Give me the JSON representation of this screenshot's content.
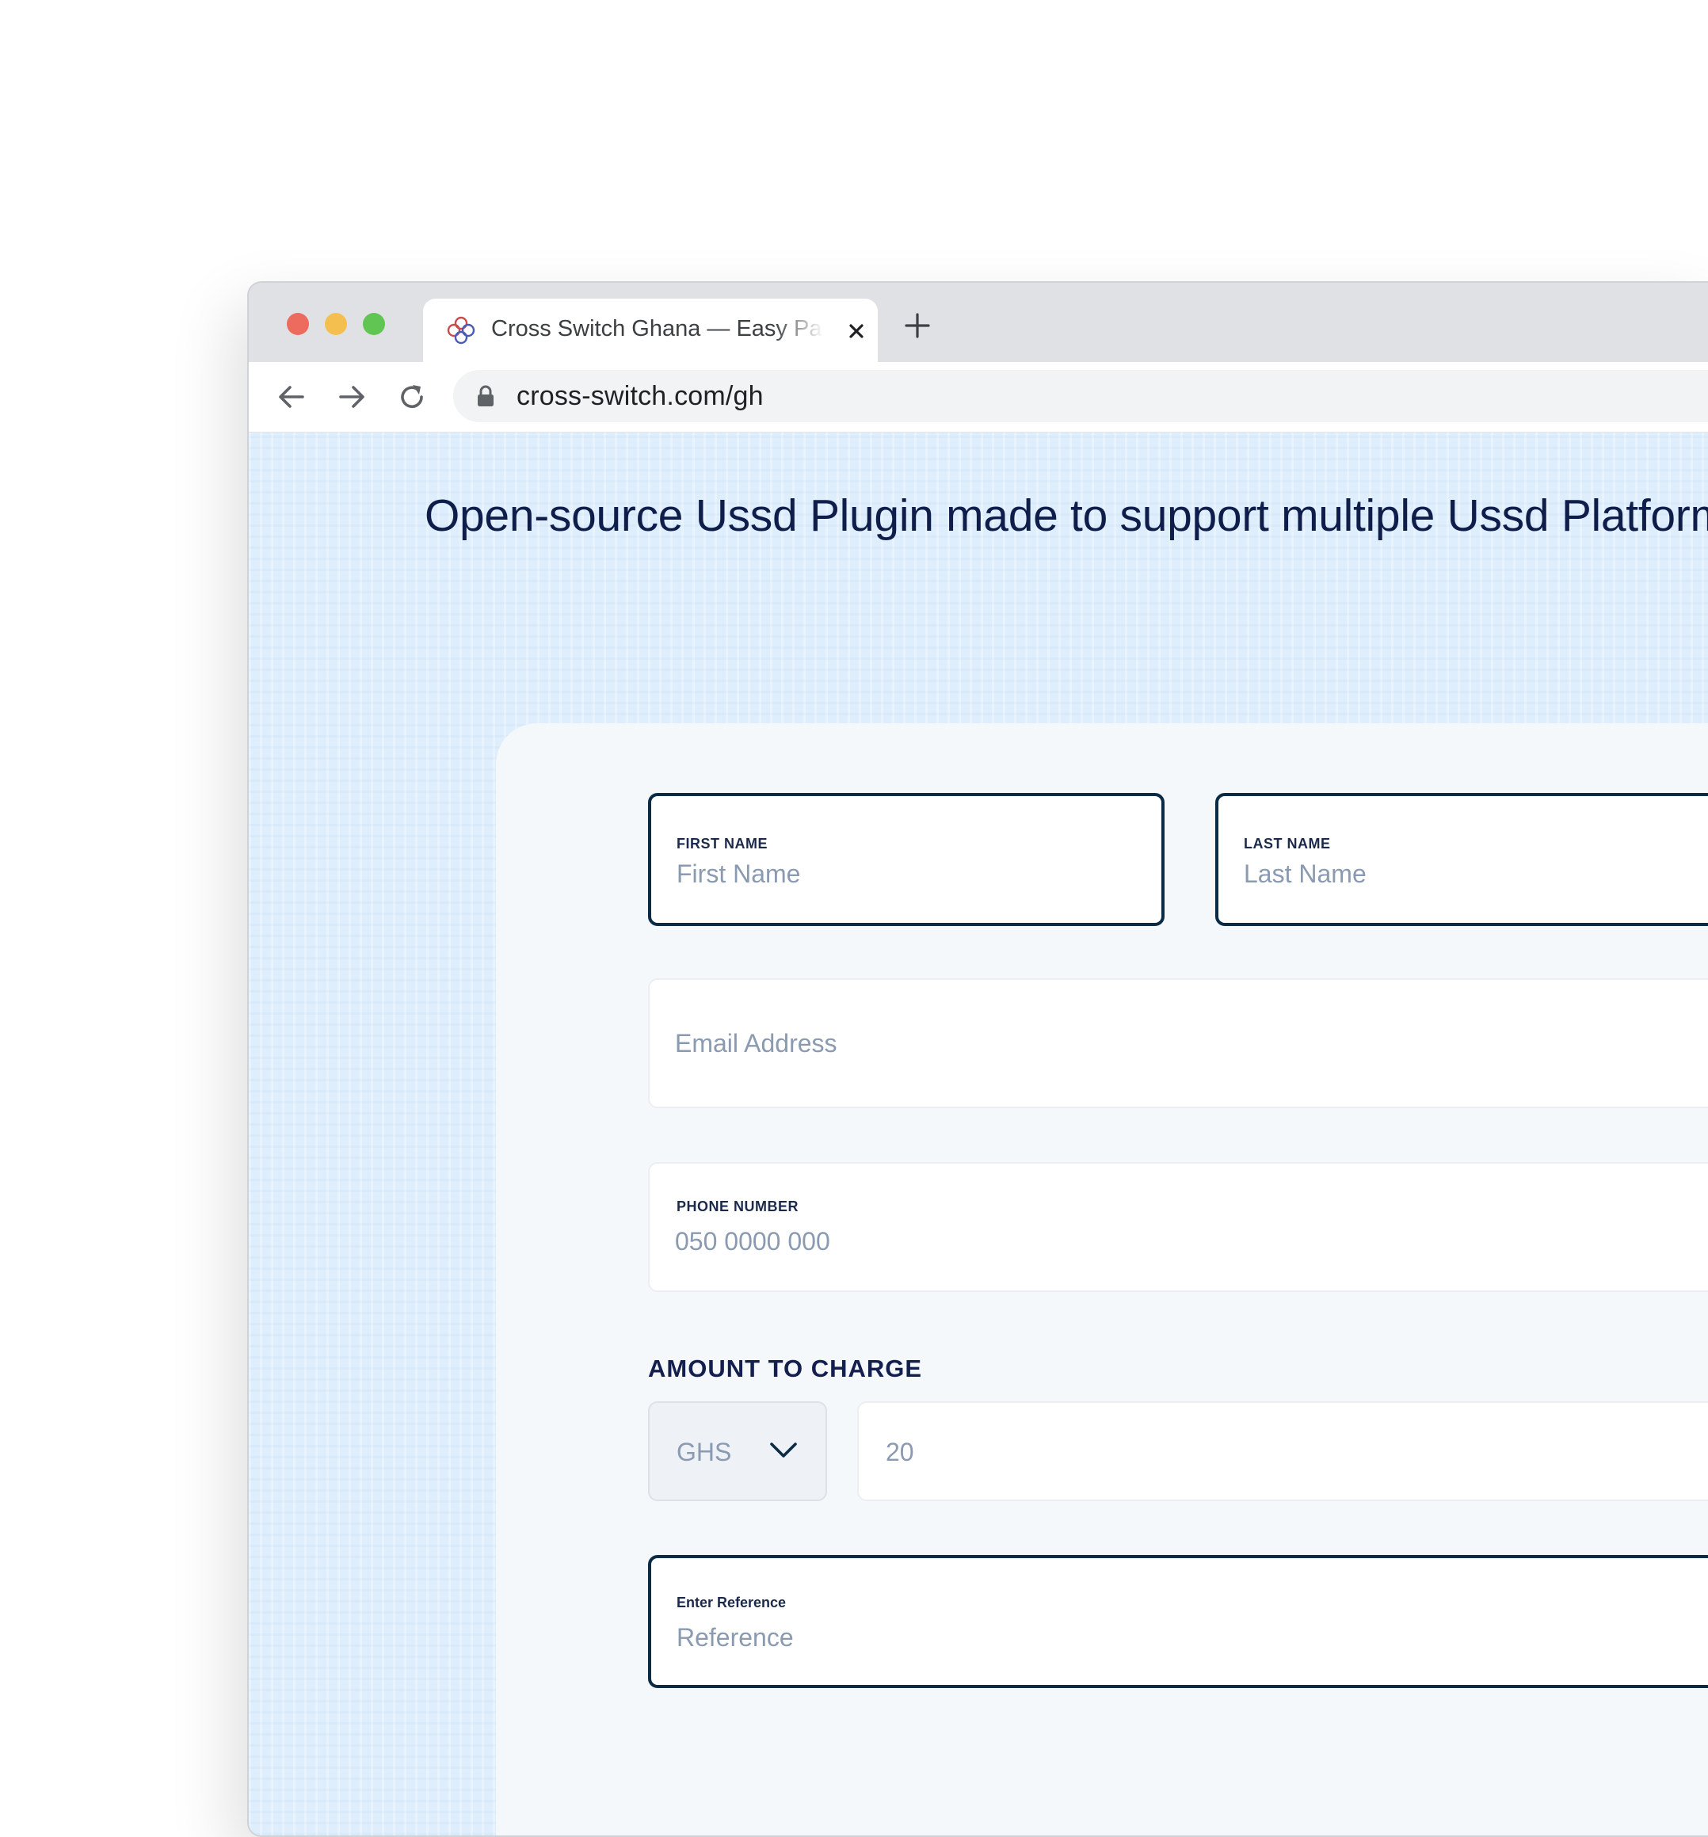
{
  "browser": {
    "tab_title": "Cross Switch Ghana — Easy Pay",
    "url": "cross-switch.com/gh"
  },
  "page": {
    "headline": "Open-source Ussd Plugin made to support multiple Ussd Platforms"
  },
  "form": {
    "first_name": {
      "label": "FIRST NAME",
      "placeholder": "First Name"
    },
    "last_name": {
      "label": "LAST NAME",
      "placeholder": "Last Name"
    },
    "email": {
      "placeholder": "Email Address"
    },
    "phone": {
      "label": "PHONE NUMBER",
      "placeholder": "050 0000 000"
    },
    "amount": {
      "section_label": "AMOUNT TO CHARGE",
      "currency": "GHS",
      "placeholder": "20"
    },
    "reference": {
      "label": "Enter Reference",
      "placeholder": "Reference"
    }
  },
  "colors": {
    "accent": "#0b2b45",
    "heading": "#0f1d4a",
    "placeholder": "#8a9ab0",
    "page_background": "#dfeefd"
  },
  "icons": [
    "tab-favicon-icon",
    "close-icon",
    "plus-icon",
    "arrow-left-icon",
    "arrow-right-icon",
    "reload-icon",
    "lock-icon",
    "chevron-down-icon"
  ]
}
